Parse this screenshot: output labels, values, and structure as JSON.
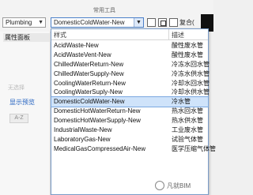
{
  "ribbon": {
    "title": "常用工具"
  },
  "toolbar": {
    "system_select": "Plumbing",
    "style_select": "DomesticColdWater-New",
    "combine_label": "复合("
  },
  "panel": {
    "header": "属性面板",
    "ghost1": "无选择",
    "preview_link": "显示预览",
    "sort_label": "A-Z"
  },
  "dropdown": {
    "col_name": "样式",
    "col_desc": "描述",
    "items": [
      {
        "name": "AcidWaste-New",
        "desc": "酸性废水管"
      },
      {
        "name": "AcidWasteVent-New",
        "desc": "酸性废水管"
      },
      {
        "name": "ChilledWaterReturn-New",
        "desc": "冷冻水回水管"
      },
      {
        "name": "ChilledWaterSupply-New",
        "desc": "冷冻水供水管"
      },
      {
        "name": "CoolingWaterReturn-New",
        "desc": "冷却水回水管"
      },
      {
        "name": "CoolingWaterSuply-New",
        "desc": "冷却水供水管"
      },
      {
        "name": "DomesticColdWater-New",
        "desc": "冷水管"
      },
      {
        "name": "DomesticHotWaterReturn-New",
        "desc": "热水回水管"
      },
      {
        "name": "DomesticHotWaterSupply-New",
        "desc": "热水供水管"
      },
      {
        "name": "IndustrialWaste-New",
        "desc": "工业废水管"
      },
      {
        "name": "LaboratoryGas-New",
        "desc": "试验气体管"
      },
      {
        "name": "MedicalGasCompressedAir-New",
        "desc": "医学压缩气体管"
      }
    ],
    "selected_index": 6
  },
  "watermark": {
    "text": "凡就BIM"
  }
}
